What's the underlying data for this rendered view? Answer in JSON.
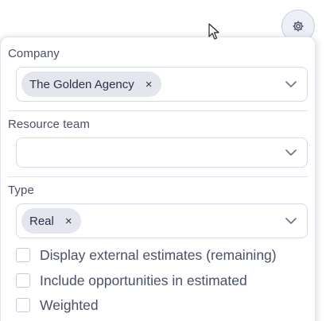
{
  "toolbar": {
    "settings_icon": "gear-icon"
  },
  "filters": {
    "company": {
      "label": "Company",
      "selected": [
        "The Golden Agency"
      ],
      "remove_glyph": "×"
    },
    "resource_team": {
      "label": "Resource team",
      "selected": []
    },
    "type": {
      "label": "Type",
      "selected": [
        "Real"
      ],
      "remove_glyph": "×"
    }
  },
  "options": [
    {
      "label": "Display external estimates (remaining)",
      "checked": false
    },
    {
      "label": "Include opportunities in estimated",
      "checked": false
    },
    {
      "label": "Weighted",
      "checked": false
    }
  ],
  "colors": {
    "chip_bg": "#e4e6ee",
    "text": "#4a4f68",
    "border": "#d6d9e3",
    "gear_bg": "#eef0f7"
  }
}
